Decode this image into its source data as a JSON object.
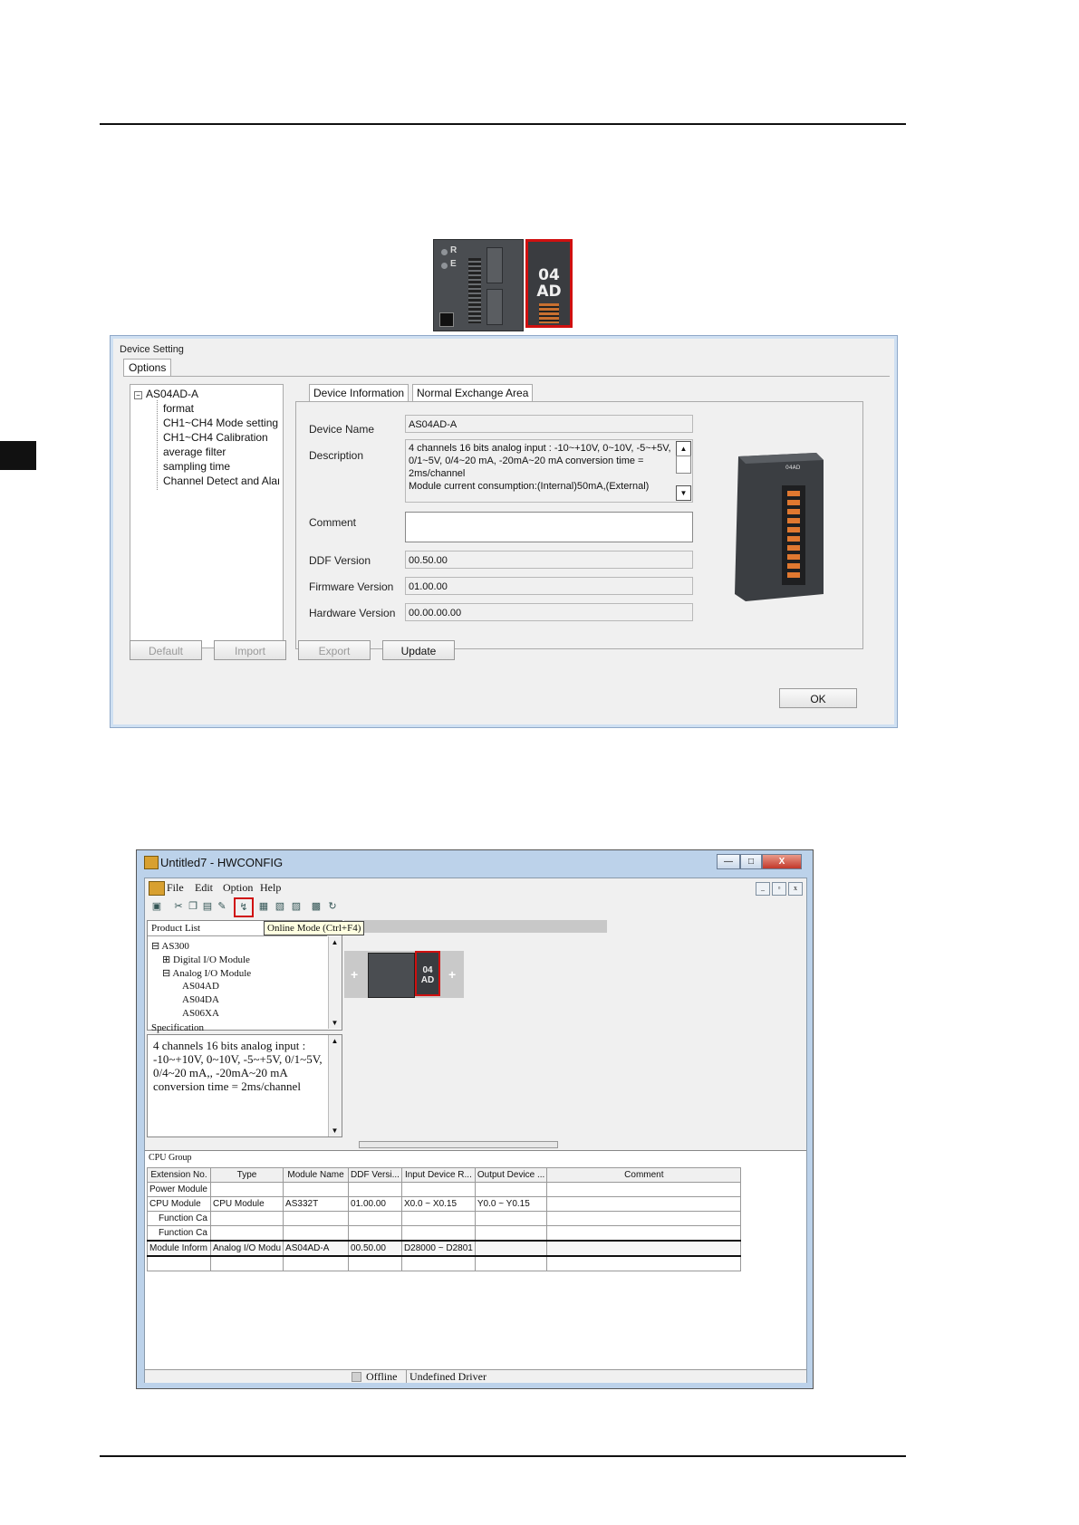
{
  "plc_picture": {
    "led_labels": [
      "R",
      "E"
    ],
    "module_line1": "04",
    "module_line2": "AD"
  },
  "device_setting": {
    "title": "Device Setting",
    "options_tab": "Options",
    "tree": {
      "root": "AS04AD-A",
      "items": [
        "format",
        "CH1~CH4 Mode setting",
        "CH1~CH4 Calibration",
        "average filter",
        "sampling time",
        "Channel Detect and Alarm"
      ]
    },
    "tabs": [
      "Device Information",
      "Normal Exchange Area"
    ],
    "fields": {
      "device_name_label": "Device Name",
      "device_name": "AS04AD-A",
      "description_label": "Description",
      "description": "4 channels 16 bits analog input : -10~+10V, 0~10V, -5~+5V, 0/1~5V, 0/4~20 mA, -20mA~20 mA conversion time = 2ms/channel\nModule current consumption:(Internal)50mA,(External)",
      "comment_label": "Comment",
      "comment": "",
      "ddf_label": "DDF Version",
      "ddf": "00.50.00",
      "firmware_label": "Firmware Version",
      "firmware": "01.00.00",
      "hardware_label": "Hardware Version",
      "hardware": "00.00.00.00"
    },
    "module_image_label": "04AD",
    "buttons": {
      "default": "Default",
      "import": "Import",
      "export": "Export",
      "update": "Update",
      "ok": "OK"
    }
  },
  "hwconfig": {
    "title": "Untitled7 - HWCONFIG",
    "caption_buttons": {
      "minimize": "—",
      "maximize": "□",
      "close": "X"
    },
    "menu": [
      "File",
      "Edit",
      "Option",
      "Help"
    ],
    "mdi_buttons": [
      "_",
      "▫",
      "x"
    ],
    "tooltip": "Online Mode (Ctrl+F4)",
    "product_list": {
      "header": "Product List",
      "items": [
        "AS300",
        "Digital I/O Module",
        "Analog I/O Module",
        "AS04AD",
        "AS04DA",
        "AS06XA"
      ]
    },
    "specification": {
      "header": "Specification",
      "text": "4 channels 16 bits analog input : -10~+10V, 0~10V, -5~+5V, 0/1~5V, 0/4~20 mA,, -20mA~20 mA conversion time = 2ms/channel"
    },
    "rack": {
      "plus": "+",
      "module_line1": "04",
      "module_line2": "AD"
    },
    "cpu_group": {
      "header": "CPU Group",
      "columns": [
        "Extension No.",
        "Type",
        "Module Name",
        "DDF Versi...",
        "Input Device R...",
        "Output Device ...",
        "Comment"
      ],
      "rows": [
        [
          "Power Module",
          "",
          "",
          "",
          "",
          "",
          ""
        ],
        [
          "CPU Module",
          "CPU Module",
          "AS332T",
          "01.00.00",
          "X0.0 ~ X0.15",
          "Y0.0 ~ Y0.15",
          ""
        ],
        [
          "Function Ca",
          "",
          "",
          "",
          "",
          "",
          ""
        ],
        [
          "Function Ca",
          "",
          "",
          "",
          "",
          "",
          ""
        ],
        [
          "Module Inform",
          "Analog I/O Modu",
          "AS04AD-A",
          "00.50.00",
          "D28000 ~ D2801",
          "",
          ""
        ],
        [
          "",
          "",
          "",
          "",
          "",
          "",
          ""
        ]
      ]
    },
    "status": {
      "mode": "Offline",
      "driver": "Undefined Driver"
    }
  }
}
